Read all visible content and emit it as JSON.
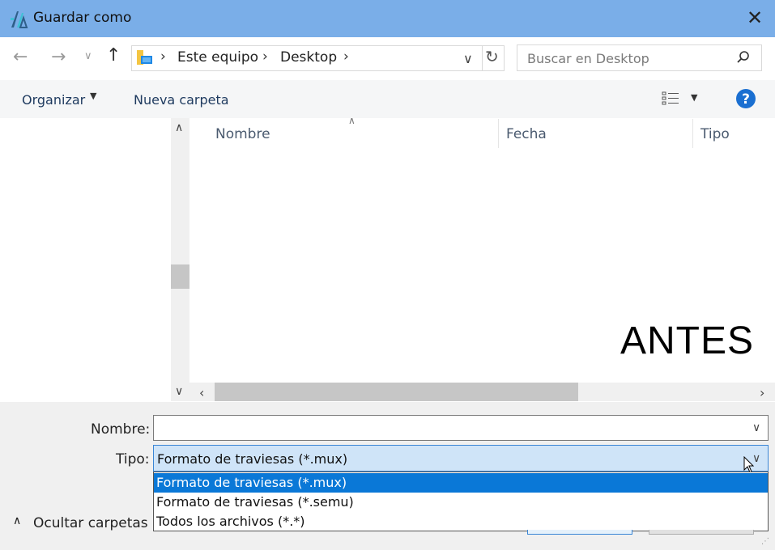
{
  "window": {
    "title": "Guardar como",
    "icon": "app-logo-icon",
    "close_icon": "close-icon"
  },
  "address_bar": {
    "back_icon": "back-arrow-icon",
    "forward_icon": "forward-arrow-icon",
    "recent_icon": "chevron-down-icon",
    "up_icon": "up-arrow-icon",
    "breadcrumbs": [
      "Este equipo",
      "Desktop"
    ],
    "refresh_icon": "refresh-icon"
  },
  "search": {
    "placeholder": "Buscar en Desktop",
    "icon": "search-icon"
  },
  "toolbar": {
    "organize_label": "Organizar",
    "new_folder_label": "Nueva carpeta",
    "help_icon": "help-icon",
    "view_icon": "details-view-icon"
  },
  "columns": [
    "Nombre",
    "Fecha",
    "Tipo"
  ],
  "watermark": "ANTES",
  "form": {
    "name_label": "Nombre:",
    "name_value": "",
    "type_label": "Tipo:",
    "type_value": "Formato de traviesas (*.mux)",
    "type_options": [
      "Formato de traviesas (*.mux)",
      "Formato de traviesas (*.semu)",
      "Todos los archivos (*.*)"
    ],
    "selected_option_index": 0
  },
  "footer": {
    "hide_folders_label": "Ocultar carpetas"
  },
  "colors": {
    "titlebar": "#7aaee8",
    "selection": "#0a78d7",
    "help": "#1a6fd1"
  }
}
